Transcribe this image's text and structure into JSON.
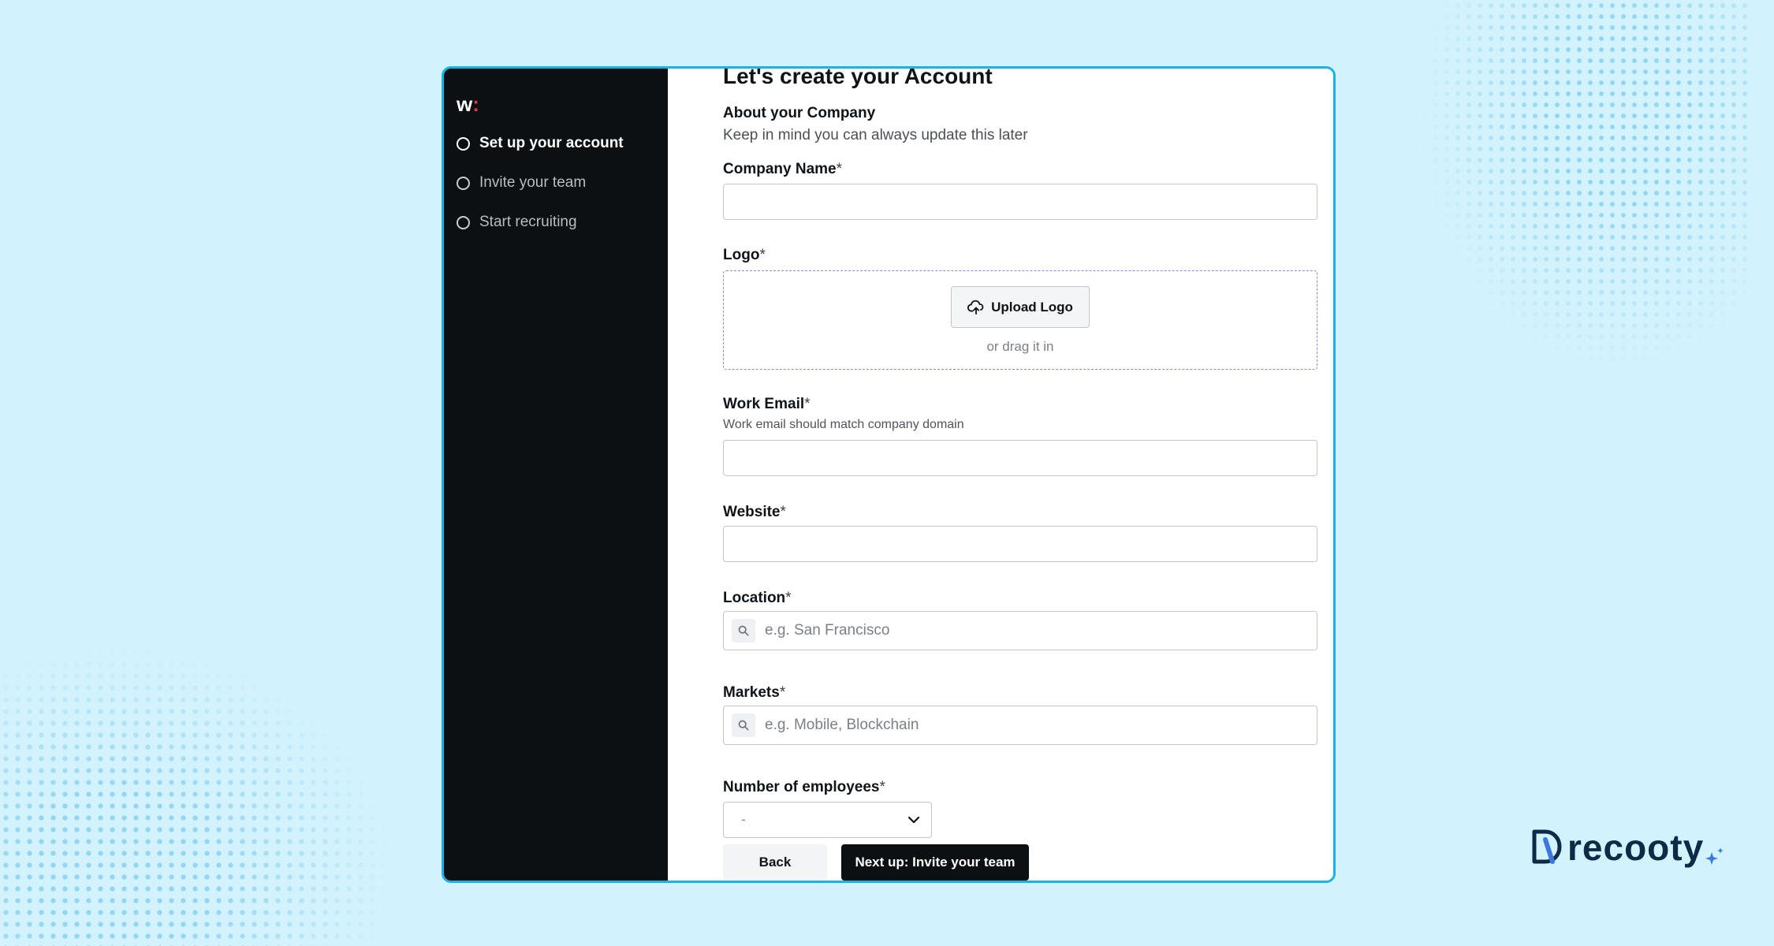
{
  "sidebar": {
    "logo_letter": "w",
    "logo_colon": ":",
    "steps": [
      {
        "label": "Set up your account",
        "active": true
      },
      {
        "label": "Invite your team",
        "active": false
      },
      {
        "label": "Start recruiting",
        "active": false
      }
    ]
  },
  "form": {
    "title": "Let's create your Account",
    "section_title": "About your Company",
    "section_subtitle": "Keep in mind you can always update this later",
    "required_mark": "*",
    "company_name": {
      "label": "Company Name",
      "value": ""
    },
    "logo": {
      "label": "Logo",
      "upload_button": "Upload Logo",
      "drag_hint": "or drag it in"
    },
    "work_email": {
      "label": "Work Email",
      "helper": "Work email should match company domain",
      "value": ""
    },
    "website": {
      "label": "Website",
      "value": ""
    },
    "location": {
      "label": "Location",
      "placeholder": "e.g. San Francisco"
    },
    "markets": {
      "label": "Markets",
      "placeholder": "e.g. Mobile, Blockchain"
    },
    "employees": {
      "label": "Number of employees",
      "selected": "-"
    },
    "back_button": "Back",
    "next_button": "Next up: Invite your team"
  },
  "brand": {
    "name": "recooty"
  },
  "colors": {
    "background": "#d2f2fd",
    "frame_border": "#1ab3e8",
    "sidebar_bg": "#0d1012",
    "logo_accent": "#e8334a",
    "dropzone_border": "#8a86e6",
    "primary_button": "#0d1012"
  },
  "icons": {
    "step": "circle-outline-icon",
    "upload": "upload-cloud-icon",
    "search": "search-icon",
    "select": "chevron-down-icon",
    "brand": "recooty-logo-icon"
  }
}
